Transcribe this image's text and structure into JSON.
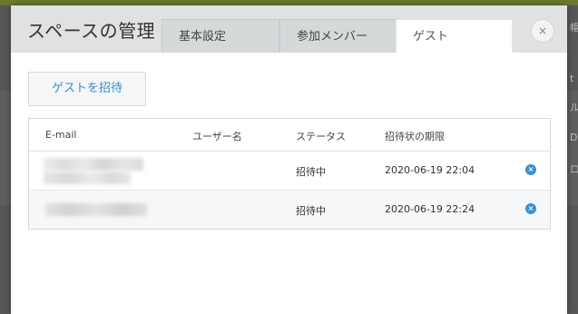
{
  "background": {
    "right_glyphs": [
      "帽",
      "t",
      "ル",
      "D",
      "ロ"
    ]
  },
  "modal": {
    "title": "スペースの管理",
    "tabs": [
      {
        "label": "基本設定"
      },
      {
        "label": "参加メンバー"
      },
      {
        "label": "ゲスト"
      }
    ],
    "close_icon": "×",
    "invite_button": "ゲストを招待",
    "table": {
      "headers": [
        "E-mail",
        "ユーザー名",
        "ステータス",
        "招待状の期限"
      ],
      "rows": [
        {
          "email": "",
          "username": "",
          "status": "招待中",
          "expiry": "2020-06-19 22:04",
          "delete_icon": "×"
        },
        {
          "email": "",
          "username": "",
          "status": "招待中",
          "expiry": "2020-06-19 22:24",
          "delete_icon": "×"
        }
      ]
    }
  },
  "colors": {
    "accent": "#3a8fc7",
    "delete": "#3d8fd1",
    "header_bg": "#dfe1e2"
  }
}
